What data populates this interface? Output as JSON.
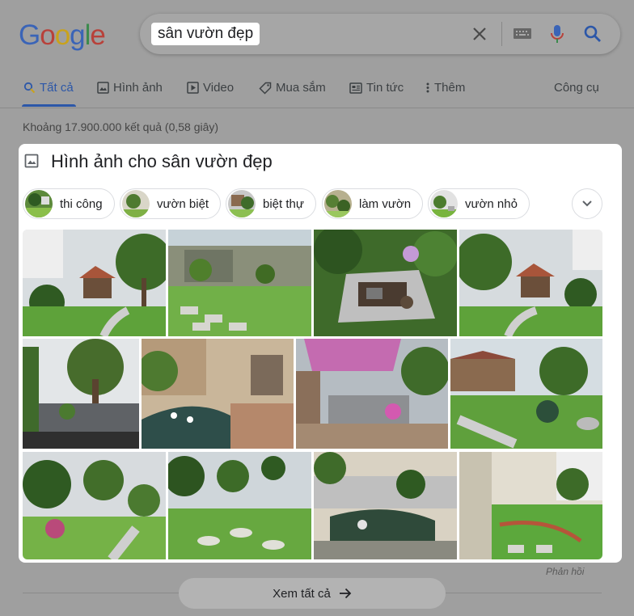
{
  "logo": {
    "letters": [
      "G",
      "o",
      "o",
      "g",
      "l",
      "e"
    ]
  },
  "search": {
    "query": "sân vườn đẹp"
  },
  "tabs": [
    {
      "label": "Tất cả",
      "icon": "search-icon",
      "active": true
    },
    {
      "label": "Hình ảnh",
      "icon": "image-icon"
    },
    {
      "label": "Video",
      "icon": "play-icon"
    },
    {
      "label": "Mua sắm",
      "icon": "tag-icon"
    },
    {
      "label": "Tin tức",
      "icon": "news-icon"
    },
    {
      "label": "Thêm",
      "icon": "more-vert-icon"
    }
  ],
  "tools_label": "Công cụ",
  "stats": "Khoảng 17.900.000 kết quả (0,58 giây)",
  "images_card": {
    "title": "Hình ảnh cho sân vườn đẹp",
    "chips": [
      "thi công",
      "vườn biệt",
      "biệt thự",
      "làm vườn",
      "vườn nhỏ"
    ]
  },
  "feedback": "Phản hồi",
  "see_all": "Xem tất cả",
  "colors": {
    "accent": "#2c57a8",
    "dimmed_bg": "#9f9f9f",
    "card_bg": "#ffffff"
  }
}
